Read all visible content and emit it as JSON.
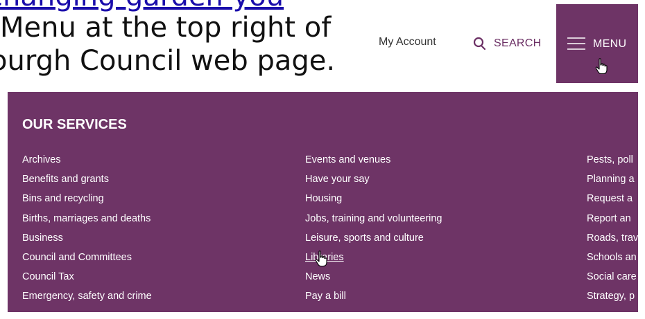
{
  "instructions": {
    "line1": "changing-garden-you",
    "line2": "Menu at the top right of",
    "line3": "ourgh Council web page."
  },
  "header": {
    "my_account": "My Account",
    "search_label": "SEARCH",
    "menu_label": "MENU"
  },
  "panel": {
    "heading": "OUR SERVICES",
    "col1": [
      "Archives",
      "Benefits and grants",
      "Bins and recycling",
      "Births, marriages and deaths",
      "Business",
      "Council and Committees",
      "Council Tax",
      "Emergency, safety and crime"
    ],
    "col2": [
      "Events and venues",
      "Have your say",
      "Housing",
      "Jobs, training and volunteering",
      "Leisure, sports and culture",
      "Libraries",
      "News",
      "Pay a bill"
    ],
    "col3": [
      "Pests, poll",
      "Planning a",
      "Request a",
      "Report an",
      "Roads, trav",
      "Schools an",
      "Social care",
      "Strategy, p"
    ]
  },
  "colors": {
    "brand_purple": "#6e3466",
    "link_blue": "#1a0dab"
  },
  "icons": {
    "search": "search-icon",
    "menu": "hamburger-icon",
    "cursor": "hand-pointer-icon"
  }
}
